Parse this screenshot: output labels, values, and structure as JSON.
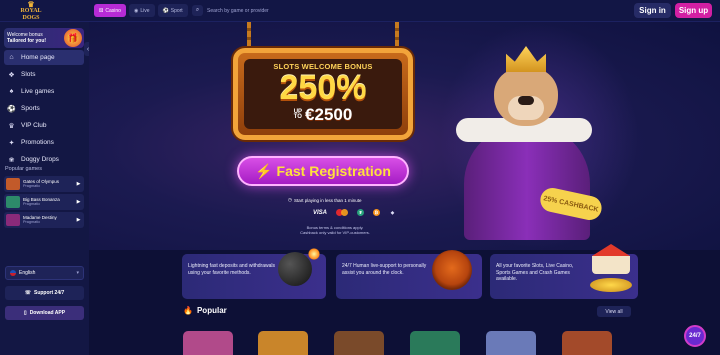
{
  "header": {
    "logo_top": "ROYAL",
    "logo_bottom": "DOGS",
    "tabs": [
      {
        "label": "Casino",
        "icon": "dice-icon"
      },
      {
        "label": "Live",
        "icon": "live-icon"
      },
      {
        "label": "Sport",
        "icon": "ball-icon"
      }
    ],
    "search_placeholder": "Search by game or provider",
    "signin_label": "Sign in",
    "signup_label": "Sign up"
  },
  "sidebar": {
    "promo_line1": "Welcome bonus",
    "promo_line2": "Tailored for you!",
    "nav": [
      {
        "label": "Home page",
        "icon": "home-icon"
      },
      {
        "label": "Slots",
        "icon": "slots-icon"
      },
      {
        "label": "Live games",
        "icon": "live-games-icon"
      },
      {
        "label": "Sports",
        "icon": "sports-icon"
      },
      {
        "label": "VIP Club",
        "icon": "vip-icon"
      },
      {
        "label": "Promotions",
        "icon": "promotions-icon"
      },
      {
        "label": "Doggy Drops",
        "icon": "doggy-drops-icon"
      }
    ],
    "popular_title": "Popular games",
    "popular_games": [
      {
        "name": "Gates of Olympus",
        "provider": "Pragmatic",
        "color": "#c25a2a"
      },
      {
        "name": "Big Bass Bonanza",
        "provider": "Pragmatic",
        "color": "#2d8a6a"
      },
      {
        "name": "Madame Destiny",
        "provider": "Pragmatic",
        "color": "#8a2a7a"
      }
    ],
    "language": "English",
    "support": "Support 24/7",
    "download": "Download APP"
  },
  "hero": {
    "subtitle": "SLOTS WELCOME BONUS",
    "percent": "250%",
    "up": "UP",
    "to": "TO",
    "amount": "€2500",
    "cta": "Fast Registration",
    "start_text": "Start playing in less than 1 minute",
    "payments": [
      "VISA",
      "mastercard",
      "tether",
      "bitcoin",
      "ethereum"
    ],
    "terms_line1": "Bonus terms & conditions apply.",
    "terms_line2": "Cashback only valid for VIP-customers.",
    "cashback": "25% CASHBACK"
  },
  "features": [
    {
      "text": "Lightning fast deposits and withdrawals using your favorite methods."
    },
    {
      "text": "24/7 Human live-support to personally assist you around the clock."
    },
    {
      "text": "All your favorite Slots, Live Casino, Sports Games and Crash Games available."
    }
  ],
  "popular": {
    "title": "Popular",
    "view_all": "View all",
    "games": [
      {
        "color": "#b14a8a"
      },
      {
        "color": "#c9852a"
      },
      {
        "color": "#7a4a2a"
      },
      {
        "color": "#2a7a5a"
      },
      {
        "color": "#6a7ab8"
      },
      {
        "color": "#a34a2a"
      }
    ]
  },
  "chat": {
    "label": "24/7"
  },
  "colors": {
    "accent": "#d21fa3",
    "casino_tab": "#b62bd6",
    "background": "#0d1036"
  }
}
